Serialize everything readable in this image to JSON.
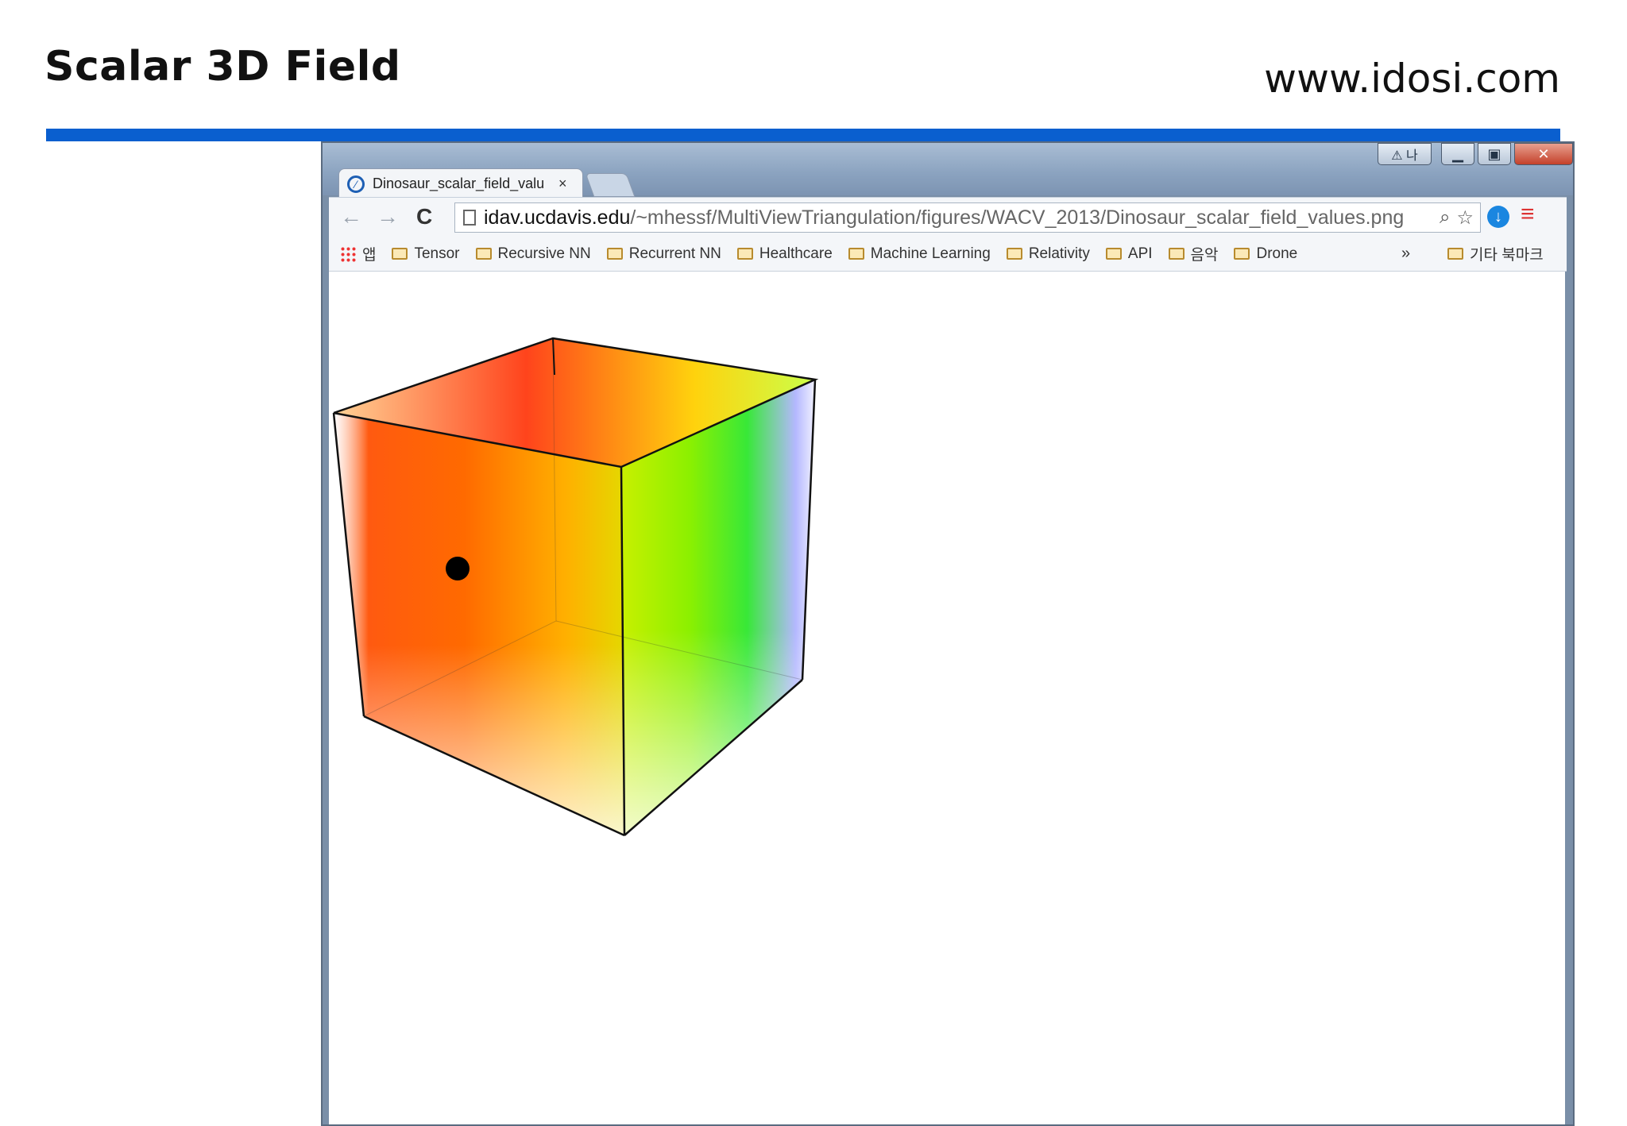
{
  "slide": {
    "title": "Scalar 3D Field",
    "website": "www.idosi.com"
  },
  "browser": {
    "user_button": "⚠ 나",
    "tab": {
      "label": "Dinosaur_scalar_field_valu",
      "close": "×"
    },
    "toolbar": {
      "back": "←",
      "forward": "→",
      "reload": "C",
      "url_host": "idav.ucdavis.edu",
      "url_path": "/~mhessf/MultiViewTriangulation/figures/WACV_2013/Dinosaur_scalar_field_values.png"
    },
    "bookmarks": {
      "apps_label": "앱",
      "items": [
        "Tensor",
        "Recursive NN",
        "Recurrent NN",
        "Healthcare",
        "Machine Learning",
        "Relativity",
        "API",
        "음악",
        "Drone"
      ],
      "more": "»",
      "other": "기타 북마크"
    }
  },
  "visual": {
    "type": "3D cube with rainbow scalar field (red → orange → yellow → green → blue)",
    "colors": [
      "#ff2a00",
      "#ff7a00",
      "#ffd000",
      "#a8ff00",
      "#33ee33",
      "#a8b4ff"
    ]
  }
}
